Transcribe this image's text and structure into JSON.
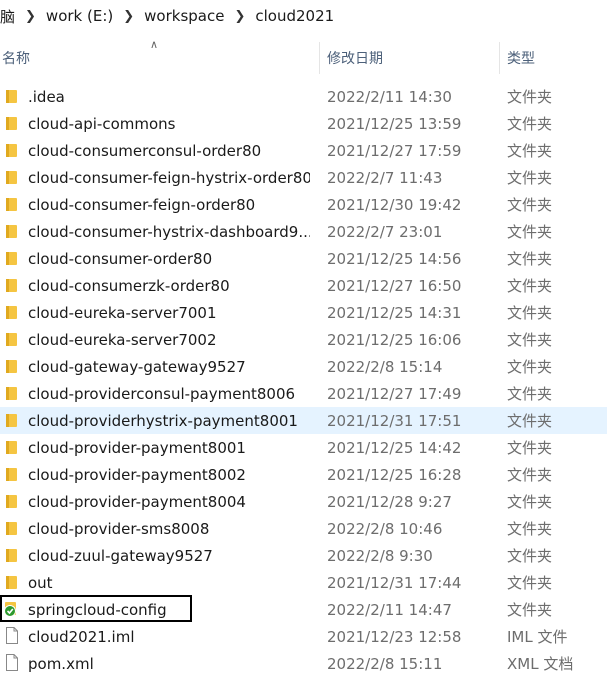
{
  "breadcrumb": {
    "items": [
      "脑",
      "work (E:)",
      "workspace",
      "cloud2021"
    ]
  },
  "header": {
    "name": "名称",
    "date": "修改日期",
    "type": "类型"
  },
  "colors": {
    "folder": "#f5c542",
    "hover_row": "#e5f3ff",
    "sync_check": "#2e9a2e"
  },
  "files": [
    {
      "name": ".idea",
      "date": "2022/2/11 14:30",
      "type": "文件夹",
      "icon": "folder-icon"
    },
    {
      "name": "cloud-api-commons",
      "date": "2021/12/25 13:59",
      "type": "文件夹",
      "icon": "folder-icon"
    },
    {
      "name": "cloud-consumerconsul-order80",
      "date": "2021/12/27 17:59",
      "type": "文件夹",
      "icon": "folder-icon"
    },
    {
      "name": "cloud-consumer-feign-hystrix-order80",
      "date": "2022/2/7 11:43",
      "type": "文件夹",
      "icon": "folder-icon"
    },
    {
      "name": "cloud-consumer-feign-order80",
      "date": "2021/12/30 19:42",
      "type": "文件夹",
      "icon": "folder-icon"
    },
    {
      "name": "cloud-consumer-hystrix-dashboard9...",
      "date": "2022/2/7 23:01",
      "type": "文件夹",
      "icon": "folder-icon"
    },
    {
      "name": "cloud-consumer-order80",
      "date": "2021/12/25 14:56",
      "type": "文件夹",
      "icon": "folder-icon"
    },
    {
      "name": "cloud-consumerzk-order80",
      "date": "2021/12/27 16:50",
      "type": "文件夹",
      "icon": "folder-icon"
    },
    {
      "name": "cloud-eureka-server7001",
      "date": "2021/12/25 14:31",
      "type": "文件夹",
      "icon": "folder-icon"
    },
    {
      "name": "cloud-eureka-server7002",
      "date": "2021/12/25 16:06",
      "type": "文件夹",
      "icon": "folder-icon"
    },
    {
      "name": "cloud-gateway-gateway9527",
      "date": "2022/2/8 15:14",
      "type": "文件夹",
      "icon": "folder-icon"
    },
    {
      "name": "cloud-providerconsul-payment8006",
      "date": "2021/12/27 17:49",
      "type": "文件夹",
      "icon": "folder-icon"
    },
    {
      "name": "cloud-providerhystrix-payment8001",
      "date": "2021/12/31 17:51",
      "type": "文件夹",
      "icon": "folder-icon",
      "hover": true
    },
    {
      "name": "cloud-provider-payment8001",
      "date": "2021/12/25 14:42",
      "type": "文件夹",
      "icon": "folder-icon"
    },
    {
      "name": "cloud-provider-payment8002",
      "date": "2021/12/25 16:28",
      "type": "文件夹",
      "icon": "folder-icon"
    },
    {
      "name": "cloud-provider-payment8004",
      "date": "2021/12/28 9:27",
      "type": "文件夹",
      "icon": "folder-icon"
    },
    {
      "name": "cloud-provider-sms8008",
      "date": "2022/2/8 10:46",
      "type": "文件夹",
      "icon": "folder-icon"
    },
    {
      "name": "cloud-zuul-gateway9527",
      "date": "2022/2/8 9:30",
      "type": "文件夹",
      "icon": "folder-icon"
    },
    {
      "name": "out",
      "date": "2021/12/31 17:44",
      "type": "文件夹",
      "icon": "folder-icon"
    },
    {
      "name": "springcloud-config",
      "date": "2022/2/11 14:47",
      "type": "文件夹",
      "icon": "synced-folder-icon",
      "focused": true
    },
    {
      "name": "cloud2021.iml",
      "date": "2021/12/23 12:58",
      "type": "IML 文件",
      "icon": "file-icon"
    },
    {
      "name": "pom.xml",
      "date": "2022/2/8 15:11",
      "type": "XML 文档",
      "icon": "file-icon"
    }
  ]
}
